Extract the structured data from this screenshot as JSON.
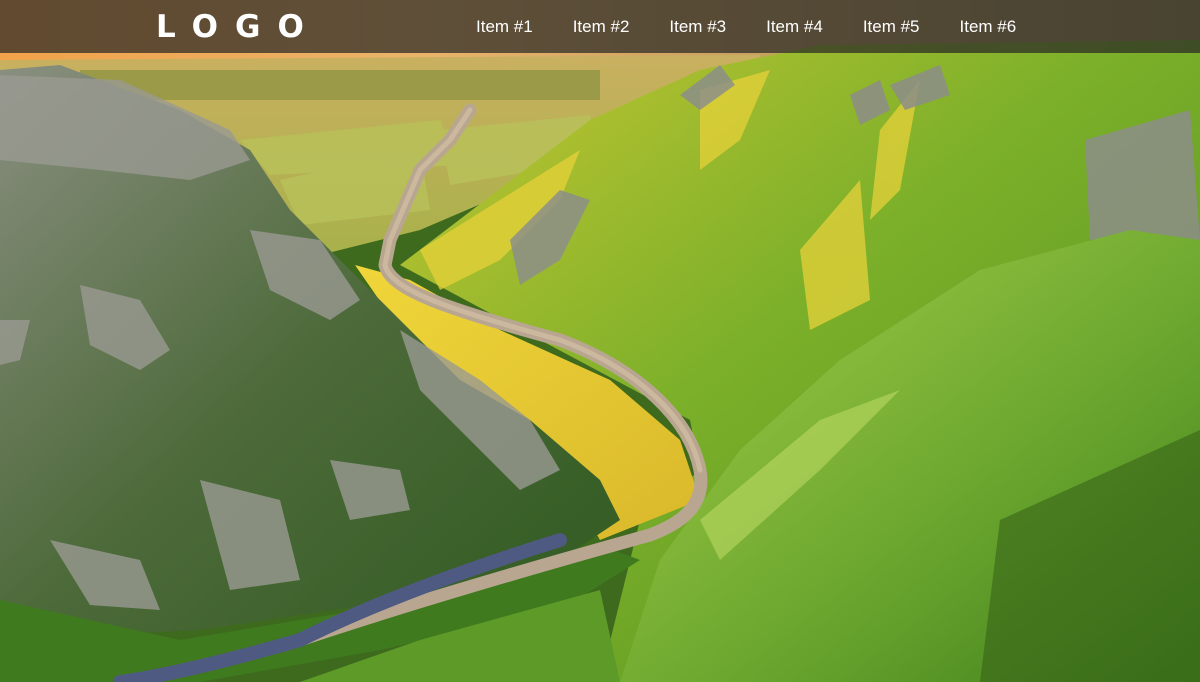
{
  "header": {
    "logo_text": "LOGO",
    "nav_items": [
      {
        "label": "Item #1"
      },
      {
        "label": "Item #2"
      },
      {
        "label": "Item #3"
      },
      {
        "label": "Item #4"
      },
      {
        "label": "Item #5"
      },
      {
        "label": "Item #6"
      }
    ]
  },
  "colors": {
    "navbar_background": "#2a2826",
    "nav_text": "#ffffff"
  }
}
